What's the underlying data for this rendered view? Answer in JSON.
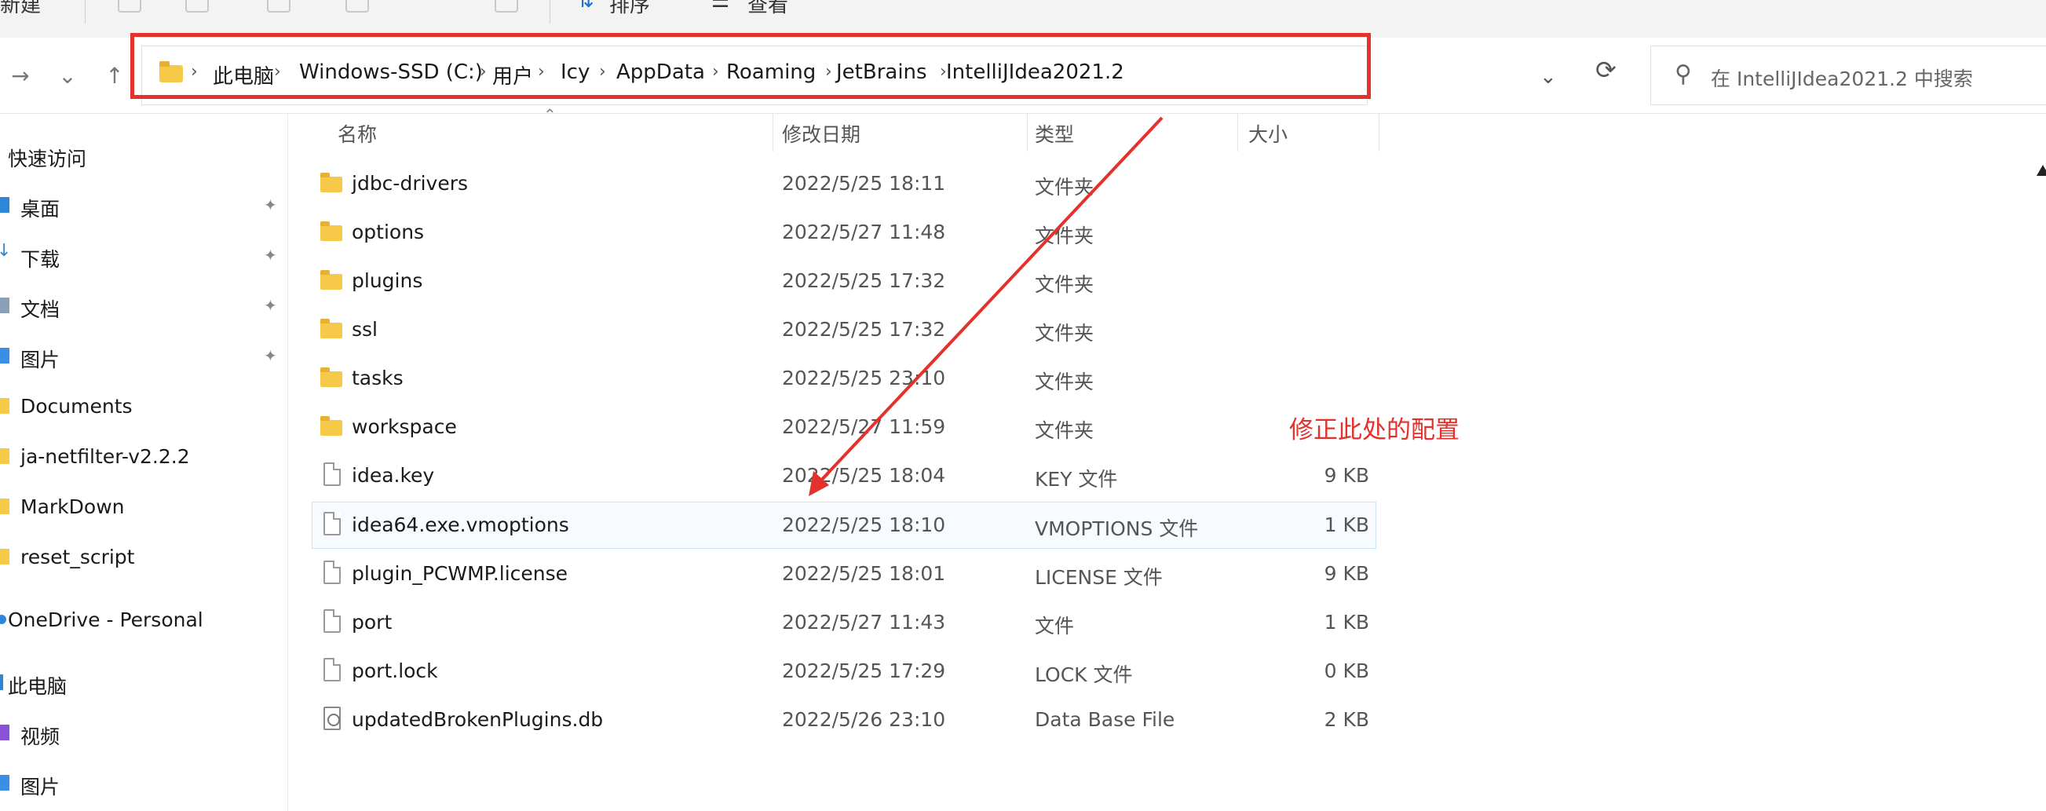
{
  "toolbar": {
    "new_label": "新建",
    "sort_label": "排序",
    "view_label": "查看"
  },
  "address": {
    "crumbs": [
      "此电脑",
      "Windows-SSD (C:)",
      "用户",
      "Icy",
      "AppData",
      "Roaming",
      "JetBrains",
      "IntelliJIdea2021.2"
    ]
  },
  "search": {
    "placeholder": "在 IntelliJIdea2021.2 中搜索"
  },
  "sidebar": {
    "items": [
      {
        "label": "快速访问"
      },
      {
        "label": "桌面"
      },
      {
        "label": "下载"
      },
      {
        "label": "文档"
      },
      {
        "label": "图片"
      },
      {
        "label": "Documents"
      },
      {
        "label": "ja-netfilter-v2.2.2"
      },
      {
        "label": "MarkDown"
      },
      {
        "label": "reset_script"
      },
      {
        "label": "OneDrive - Personal"
      },
      {
        "label": "此电脑"
      },
      {
        "label": "视频"
      },
      {
        "label": "图片"
      }
    ]
  },
  "columns": {
    "name": "名称",
    "date": "修改日期",
    "type": "类型",
    "size": "大小"
  },
  "files": [
    {
      "name": "jdbc-drivers",
      "date": "2022/5/25 18:11",
      "type": "文件夹",
      "size": ""
    },
    {
      "name": "options",
      "date": "2022/5/27 11:48",
      "type": "文件夹",
      "size": ""
    },
    {
      "name": "plugins",
      "date": "2022/5/25 17:32",
      "type": "文件夹",
      "size": ""
    },
    {
      "name": "ssl",
      "date": "2022/5/25 17:32",
      "type": "文件夹",
      "size": ""
    },
    {
      "name": "tasks",
      "date": "2022/5/25 23:10",
      "type": "文件夹",
      "size": ""
    },
    {
      "name": "workspace",
      "date": "2022/5/27 11:59",
      "type": "文件夹",
      "size": ""
    },
    {
      "name": "idea.key",
      "date": "2022/5/25 18:04",
      "type": "KEY 文件",
      "size": "9 KB"
    },
    {
      "name": "idea64.exe.vmoptions",
      "date": "2022/5/25 18:10",
      "type": "VMOPTIONS 文件",
      "size": "1 KB"
    },
    {
      "name": "plugin_PCWMP.license",
      "date": "2022/5/25 18:01",
      "type": "LICENSE 文件",
      "size": "9 KB"
    },
    {
      "name": "port",
      "date": "2022/5/27 11:43",
      "type": "文件",
      "size": "1 KB"
    },
    {
      "name": "port.lock",
      "date": "2022/5/25 17:29",
      "type": "LOCK 文件",
      "size": "0 KB"
    },
    {
      "name": "updatedBrokenPlugins.db",
      "date": "2022/5/26 23:10",
      "type": "Data Base File",
      "size": "2 KB"
    }
  ],
  "annotation": {
    "text": "修正此处的配置",
    "color": "#e4312b"
  },
  "icons": {
    "back": "←",
    "forward": "→",
    "recent": "⌄",
    "up": "↑",
    "dropdown": "⌄",
    "refresh": "⟳",
    "search": "⚲",
    "pin": "📌"
  }
}
